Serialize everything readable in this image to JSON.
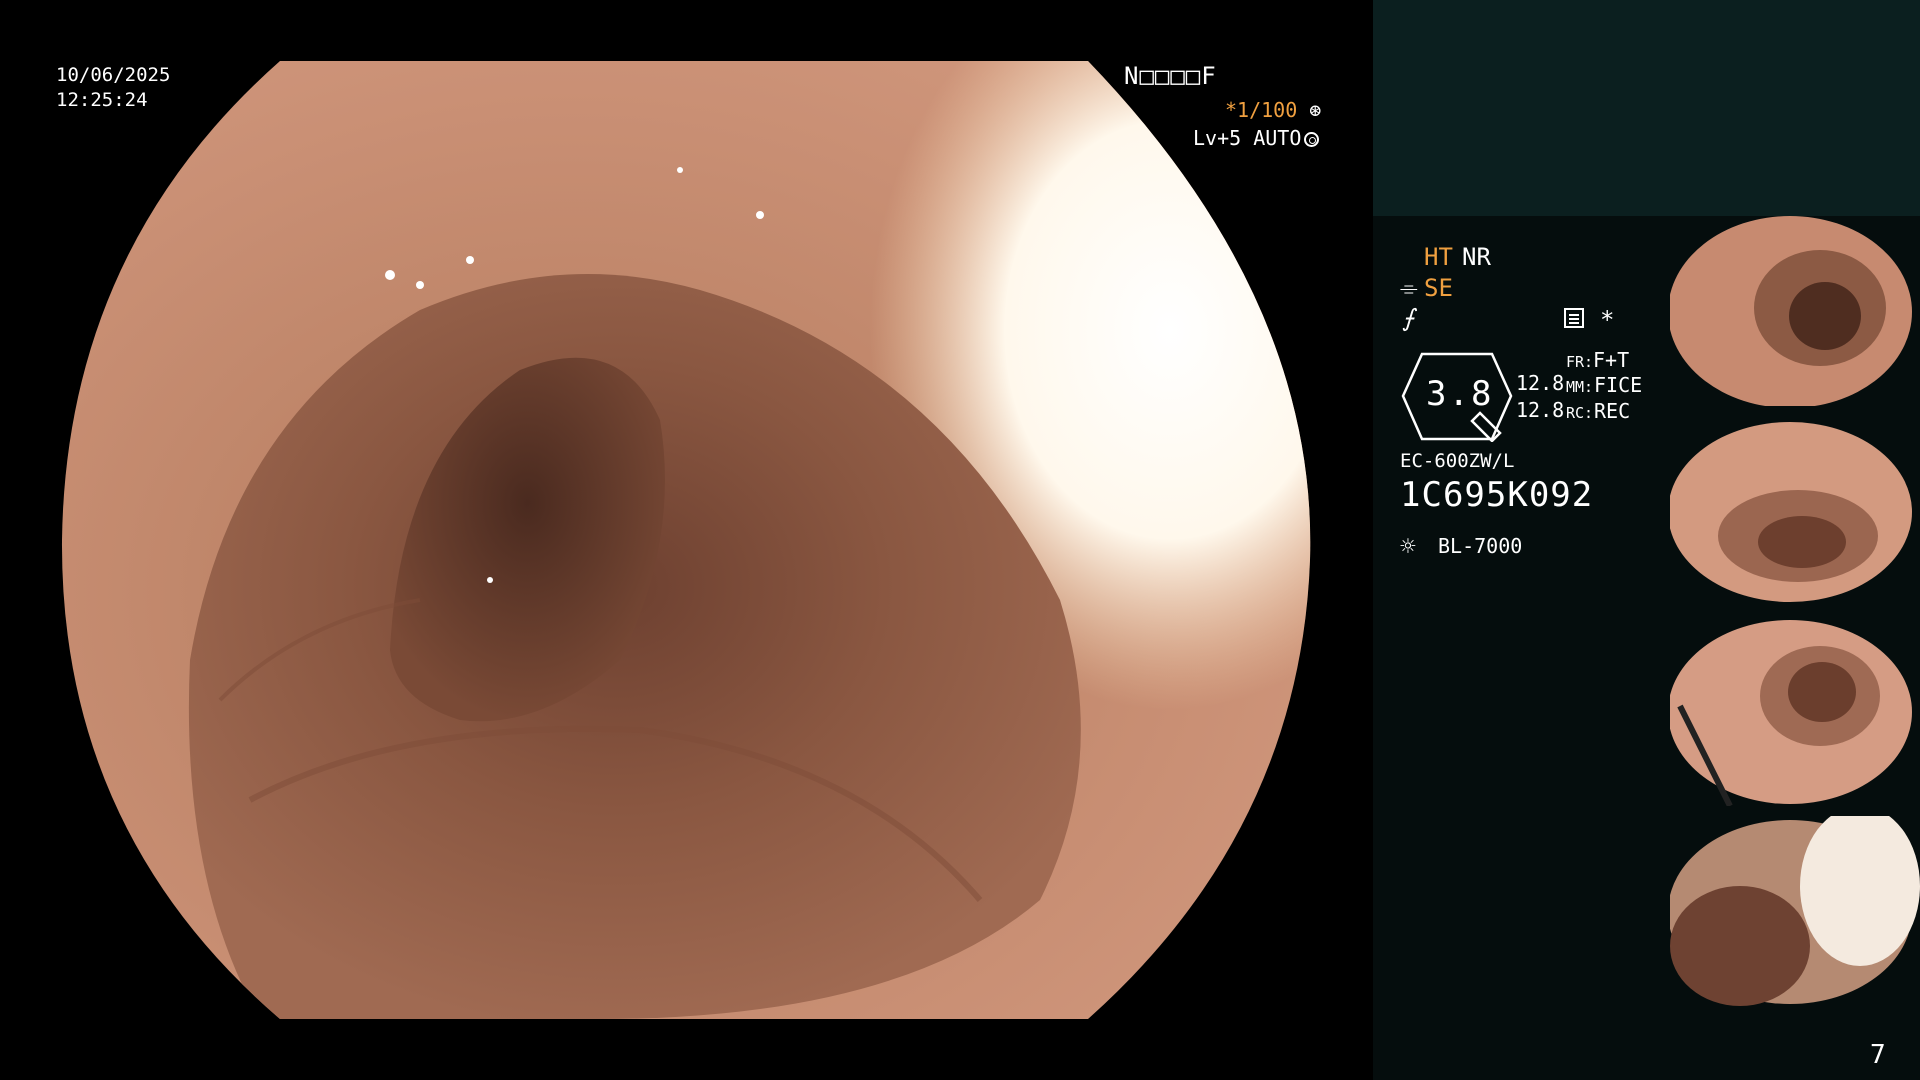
{
  "osd": {
    "date": "10/06/2025",
    "time": "12:25:24",
    "patient_code": "N□□□□F",
    "shutter_speed": "*1/100",
    "level": "Lv+5",
    "iris_mode": "AUTO"
  },
  "panel": {
    "ht": "HT",
    "nr": "NR",
    "se": "SE",
    "zoom_value": "3.8",
    "value_1": "12.8",
    "value_2": "12.8",
    "fr_label": "FR:",
    "fr_value": "F+T",
    "mm_label": "MM:",
    "mm_value": "FICE",
    "rc_label": "RC:",
    "rc_value": "REC",
    "scope_model": "EC-600ZW/L",
    "scope_serial": "1C695K092",
    "light_source": "BL-7000",
    "page_number": "7"
  },
  "icons": {
    "shutter": "aperture-icon",
    "iris": "iris-icon",
    "enhance": "structure-enhance-icon",
    "freeze": "freeze-icon",
    "memo": "memo-icon",
    "light": "lamp-icon"
  },
  "colors": {
    "accent_orange": "#f0a040",
    "panel_top": "#0b1f1f",
    "panel_side": "#050d0d"
  },
  "thumbnails": [
    {
      "name": "thumbnail-1"
    },
    {
      "name": "thumbnail-2"
    },
    {
      "name": "thumbnail-3"
    },
    {
      "name": "thumbnail-4"
    }
  ]
}
